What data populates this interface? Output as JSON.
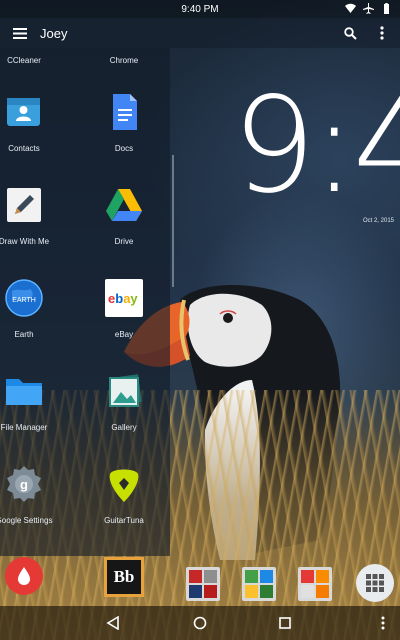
{
  "status_bar": {
    "time": "9:40 PM",
    "icons": [
      "wifi-icon",
      "airplane-icon",
      "battery-icon"
    ]
  },
  "app_bar": {
    "title": "Joey",
    "actions": [
      "search-icon",
      "overflow-menu-icon"
    ]
  },
  "drawer": {
    "apps": [
      {
        "label": "CCleaner",
        "icon": "ccleaner-icon"
      },
      {
        "label": "Chrome",
        "icon": "chrome-icon"
      },
      {
        "label": "Contacts",
        "icon": "contacts-icon"
      },
      {
        "label": "Docs",
        "icon": "docs-icon"
      },
      {
        "label": "Draw With Me",
        "icon": "pencil-icon"
      },
      {
        "label": "Drive",
        "icon": "drive-icon"
      },
      {
        "label": "Earth",
        "icon": "earth-icon"
      },
      {
        "label": "eBay",
        "icon": "ebay-icon"
      },
      {
        "label": "File Manager",
        "icon": "folder-icon"
      },
      {
        "label": "Gallery",
        "icon": "gallery-icon"
      },
      {
        "label": "Google Settings",
        "icon": "google-settings-icon"
      },
      {
        "label": "GuitarTuna",
        "icon": "guitar-pick-icon"
      }
    ]
  },
  "clock": {
    "time": "9:4",
    "date": "Oct 2, 2015"
  },
  "dock": {
    "items": [
      {
        "icon": "drop-icon",
        "color": "#e53935"
      },
      {
        "icon": "blackboard-icon",
        "text": "Bb"
      },
      {
        "icon": "folder-group-icon"
      },
      {
        "icon": "folder-group-icon"
      },
      {
        "icon": "folder-group-icon"
      },
      {
        "icon": "app-grid-icon"
      }
    ]
  },
  "nav_bar": {
    "buttons": [
      "back-icon",
      "home-icon",
      "recents-icon",
      "overflow-menu-icon"
    ]
  },
  "colors": {
    "accent_red": "#e53935",
    "bb_gold": "#e6a23c",
    "drawer_bg": "#121c28"
  }
}
